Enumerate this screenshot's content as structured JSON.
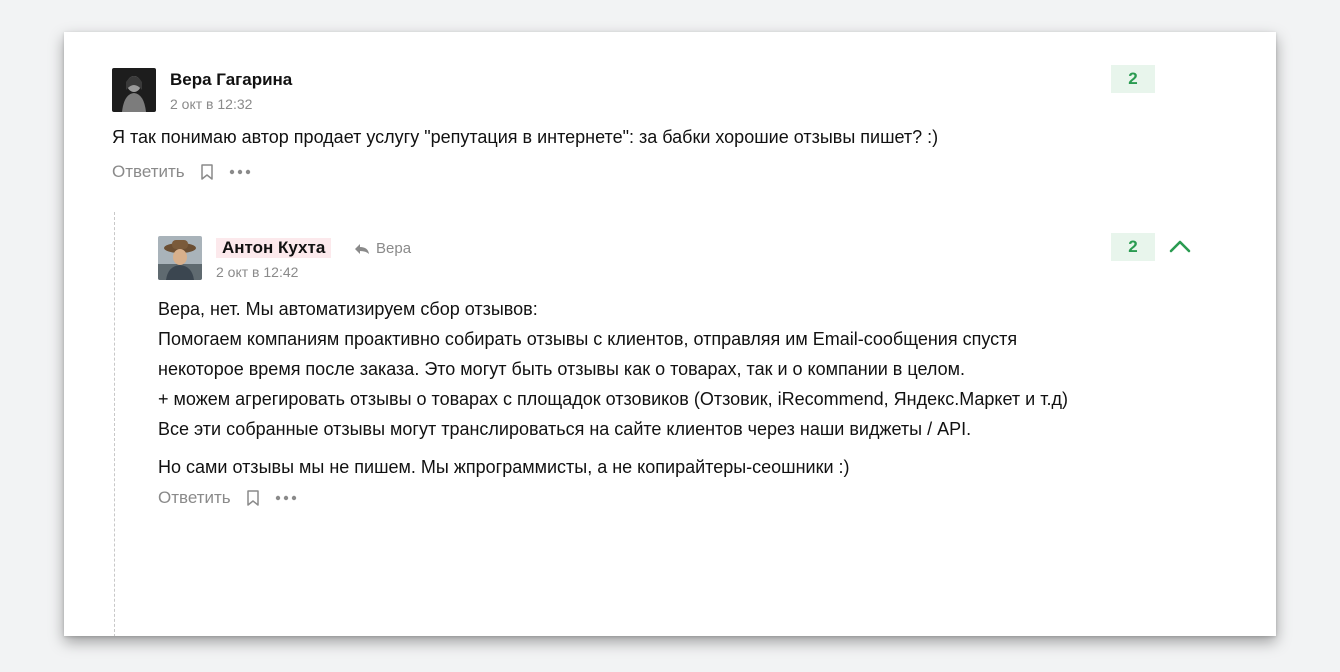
{
  "comments": [
    {
      "author": "Вера Гагарина",
      "date": "2 окт в 12:32",
      "score": "2",
      "paragraphs": [
        "Я так понимаю автор продает услугу \"репутация в интернете\": за бабки хорошие отзывы пишет? :)"
      ],
      "actions": {
        "reply": "Ответить"
      }
    },
    {
      "author": "Антон Кухта",
      "reply_to": "Вера",
      "date": "2 окт в 12:42",
      "score": "2",
      "paragraphs": [
        "Вера, нет. Мы автоматизируем сбор отзывов:\nПомогаем компаниям проактивно собирать отзывы с клиентов, отправляя им Email-сообщения спустя некоторое время после заказа. Это могут быть отзывы как о товарах, так и о компании в целом.\n+ можем агрегировать отзывы о товарах с площадок отзовиков (Отзовик, iRecommend, Яндекс.Маркет и т.д)\nВсе эти собранные отзывы могут транслироваться на сайте клиентов через наши виджеты / API.",
        "Но сами отзывы мы не пишем. Мы жпрограммисты, а не копирайтеры-сеошники :)"
      ],
      "actions": {
        "reply": "Ответить"
      }
    }
  ],
  "colors": {
    "score_bg": "#e8f5ec",
    "score_text": "#2a9b51",
    "author_highlight": "#fce9ec",
    "muted": "#8a8a8a"
  },
  "icons": [
    "bookmark-icon",
    "more-icon",
    "reply-arrow-icon",
    "chevron-up-icon"
  ]
}
